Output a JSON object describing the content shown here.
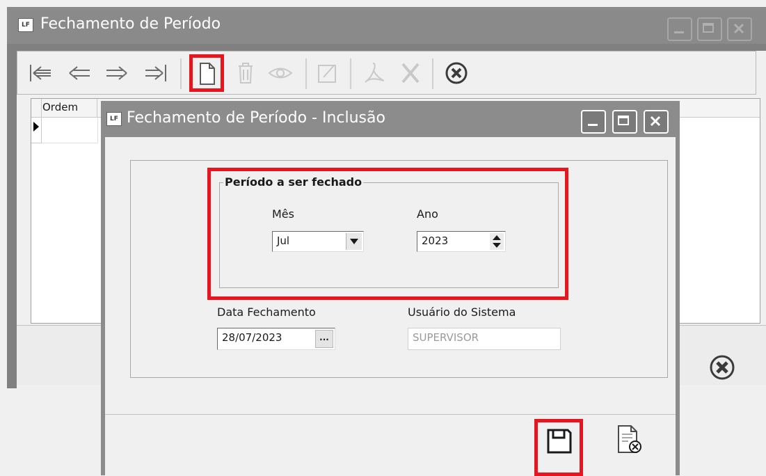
{
  "main_window": {
    "title": "Fechamento de Período",
    "app_icon_label": "LF",
    "icons": {
      "first": "first-record-icon",
      "prev": "previous-record-icon",
      "next": "next-record-icon",
      "last": "last-record-icon",
      "new": "new-document-icon",
      "delete": "trash-icon",
      "view": "eye-icon",
      "edit": "edit-icon",
      "pdf": "pdf-icon",
      "excel": "excel-icon",
      "close": "close-circle-icon"
    },
    "grid": {
      "columns": [
        "Ordem"
      ]
    }
  },
  "dialog": {
    "title": "Fechamento de Período  - Inclusão",
    "app_icon_label": "LF",
    "period_group": {
      "title": "Período a ser fechado",
      "month_label": "Mês",
      "month_value": "Jul",
      "year_label": "Ano",
      "year_value": "2023"
    },
    "close_date_label": "Data Fechamento",
    "close_date_value": "28/07/2023",
    "ellipsis": "...",
    "user_label": "Usuário do Sistema",
    "user_value": "SUPERVISOR",
    "footer_icons": {
      "save": "save-disk-icon",
      "cancel": "cancel-document-icon"
    }
  },
  "colors": {
    "highlight": "#e8141e",
    "title_bar": "#8a8a8a"
  }
}
